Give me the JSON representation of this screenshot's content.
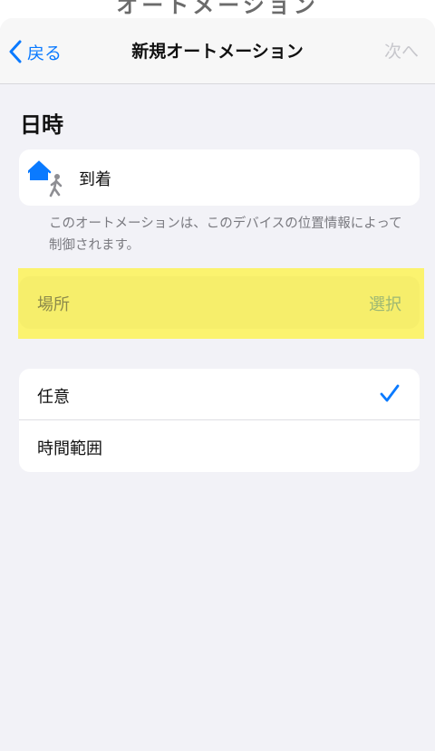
{
  "background_title": "オートメーション",
  "nav": {
    "back_label": "戻る",
    "title": "新規オートメーション",
    "next_label": "次へ"
  },
  "section": {
    "title": "日時"
  },
  "trigger": {
    "icon": "home-person-walking-icon",
    "label": "到着"
  },
  "footnote": "このオートメーションは、このデバイスの位置情報によって制御されます。",
  "location": {
    "label": "場所",
    "action": "選択"
  },
  "options": [
    {
      "label": "任意",
      "selected": true
    },
    {
      "label": "時間範囲",
      "selected": false
    }
  ],
  "colors": {
    "accent": "#0a7aff",
    "highlight": "#fbf36f",
    "background": "#f2f2f7"
  }
}
